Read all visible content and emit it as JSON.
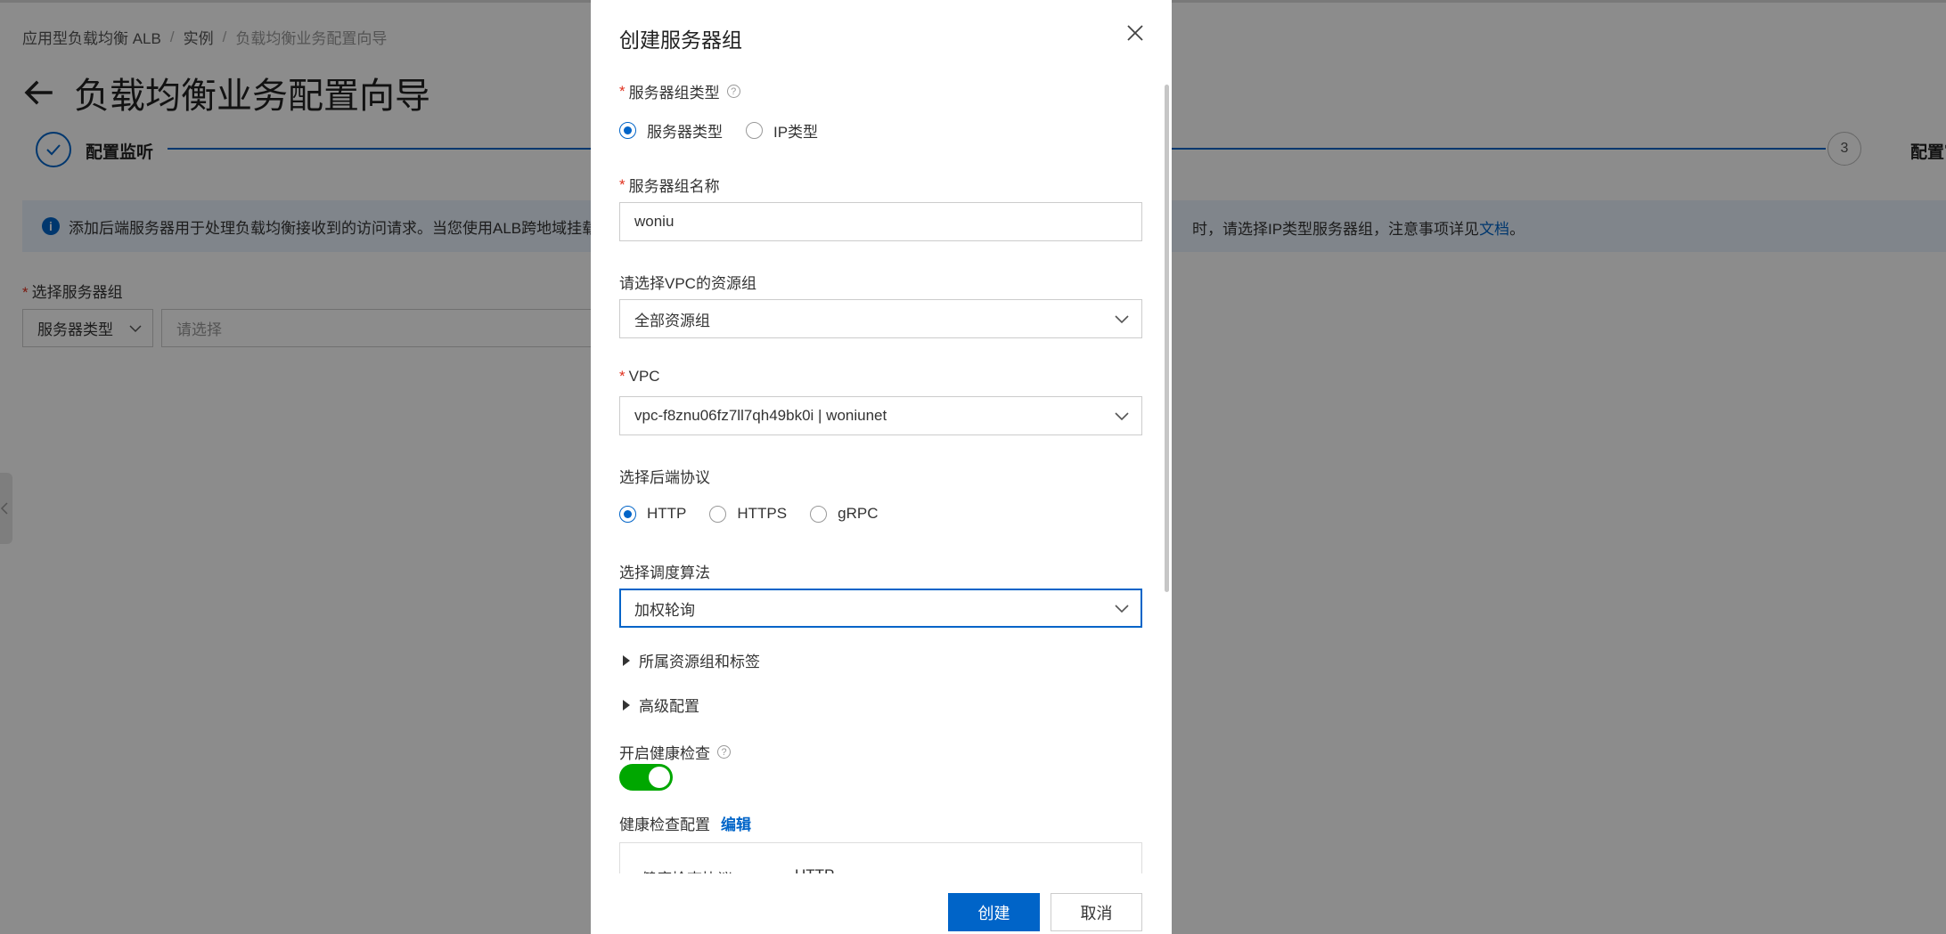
{
  "breadcrumb": [
    "应用型负载均衡 ALB",
    "实例",
    "负载均衡业务配置向导"
  ],
  "page": {
    "title": "负载均衡业务配置向导"
  },
  "steps": {
    "step1_label": "配置监听",
    "step3_number": "3",
    "step3_label": "配置审核"
  },
  "info": {
    "text_left": "添加后端服务器用于处理负载均衡接收到的访问请求。当您使用ALB跨地域挂载后端",
    "text_right": "时，请选择IP类型服务器组，注意事项详见",
    "link": "文档",
    "period": "。"
  },
  "server_group_select": {
    "label": "选择服务器组",
    "type_value": "服务器类型",
    "placeholder": "请选择"
  },
  "dialog": {
    "title": "创建服务器组",
    "group_type": {
      "label": "服务器组类型",
      "options": [
        "服务器类型",
        "IP类型"
      ],
      "selected": "服务器类型"
    },
    "group_name": {
      "label": "服务器组名称",
      "value": "woniu"
    },
    "resource_group": {
      "label": "请选择VPC的资源组",
      "value": "全部资源组"
    },
    "vpc": {
      "label": "VPC",
      "value": "vpc-f8znu06fz7ll7qh49bk0i | woniunet"
    },
    "protocol": {
      "label": "选择后端协议",
      "options": [
        "HTTP",
        "HTTPS",
        "gRPC"
      ],
      "selected": "HTTP"
    },
    "algorithm": {
      "label": "选择调度算法",
      "value": "加权轮询"
    },
    "collapse_tags": "所属资源组和标签",
    "collapse_advanced": "高级配置",
    "health_check": {
      "label": "开启健康检查",
      "enabled": true
    },
    "health_config": {
      "label": "健康检查配置",
      "edit": "编辑",
      "row_key": "健康检查协议",
      "row_value": "HTTP"
    },
    "create_button": "创建",
    "cancel_button": "取消"
  },
  "colors": {
    "primary": "#0064c8",
    "toggle_on": "#00a700",
    "required": "#e0301e",
    "info_bg": "#eaf3fd"
  }
}
